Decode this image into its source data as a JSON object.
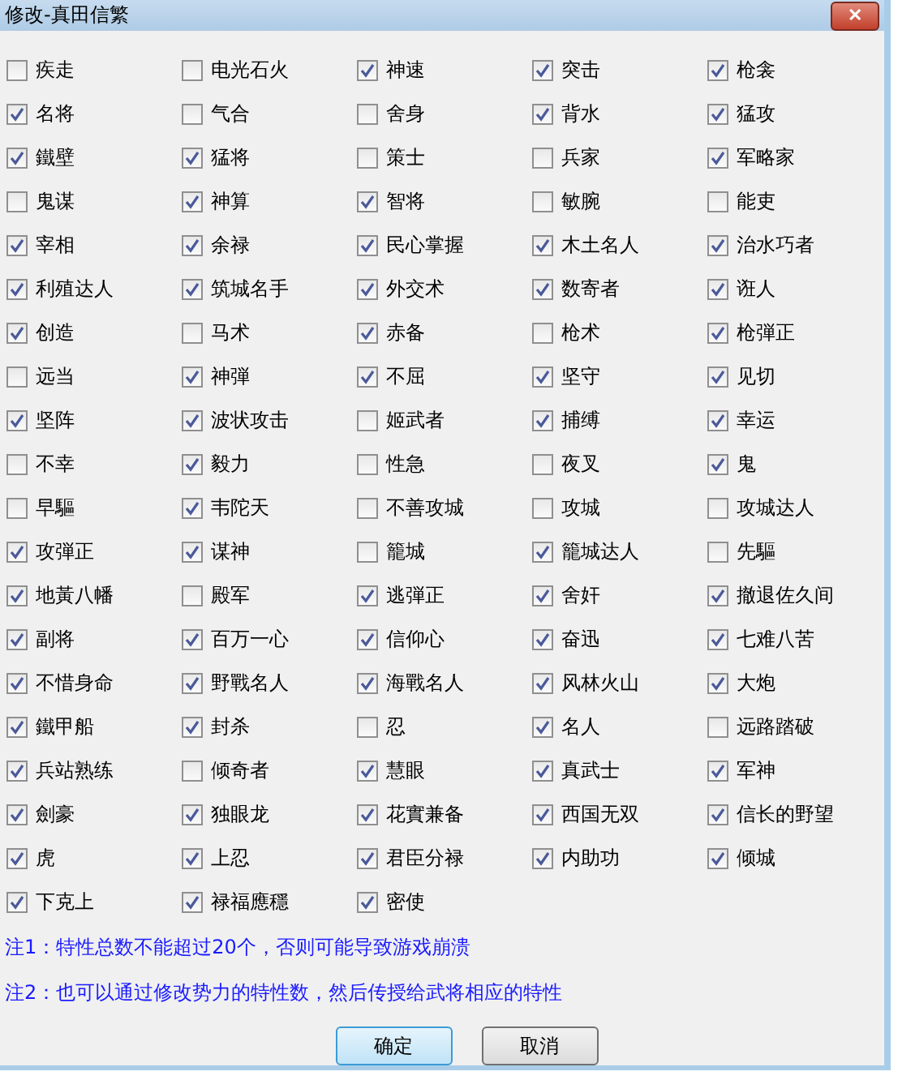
{
  "window": {
    "title": "修改-真田信繁",
    "close": "✕"
  },
  "traits": [
    {
      "label": "疾走",
      "checked": false
    },
    {
      "label": "电光石火",
      "checked": false
    },
    {
      "label": "神速",
      "checked": true
    },
    {
      "label": "突击",
      "checked": true
    },
    {
      "label": "枪衾",
      "checked": true
    },
    {
      "label": "名将",
      "checked": true
    },
    {
      "label": "气合",
      "checked": false
    },
    {
      "label": "舍身",
      "checked": false
    },
    {
      "label": "背水",
      "checked": true
    },
    {
      "label": "猛攻",
      "checked": true
    },
    {
      "label": "鐵壁",
      "checked": true
    },
    {
      "label": "猛将",
      "checked": true
    },
    {
      "label": "策士",
      "checked": false
    },
    {
      "label": "兵家",
      "checked": false
    },
    {
      "label": "军略家",
      "checked": true
    },
    {
      "label": "鬼谋",
      "checked": false
    },
    {
      "label": "神算",
      "checked": true
    },
    {
      "label": "智将",
      "checked": true
    },
    {
      "label": "敏腕",
      "checked": false
    },
    {
      "label": "能吏",
      "checked": false
    },
    {
      "label": "宰相",
      "checked": true
    },
    {
      "label": "余禄",
      "checked": true
    },
    {
      "label": "民心掌握",
      "checked": true
    },
    {
      "label": "木土名人",
      "checked": true
    },
    {
      "label": "治水巧者",
      "checked": true
    },
    {
      "label": "利殖达人",
      "checked": true
    },
    {
      "label": "筑城名手",
      "checked": true
    },
    {
      "label": "外交术",
      "checked": true
    },
    {
      "label": "数寄者",
      "checked": true
    },
    {
      "label": "诳人",
      "checked": true
    },
    {
      "label": "创造",
      "checked": true
    },
    {
      "label": "马术",
      "checked": false
    },
    {
      "label": "赤备",
      "checked": true
    },
    {
      "label": "枪术",
      "checked": false
    },
    {
      "label": "枪弾正",
      "checked": true
    },
    {
      "label": "远当",
      "checked": false
    },
    {
      "label": "神弾",
      "checked": true
    },
    {
      "label": "不屈",
      "checked": true
    },
    {
      "label": "坚守",
      "checked": true
    },
    {
      "label": "见切",
      "checked": true
    },
    {
      "label": "坚阵",
      "checked": true
    },
    {
      "label": "波状攻击",
      "checked": true
    },
    {
      "label": "姬武者",
      "checked": false
    },
    {
      "label": "捕缚",
      "checked": true
    },
    {
      "label": "幸运",
      "checked": true
    },
    {
      "label": "不幸",
      "checked": false
    },
    {
      "label": "毅力",
      "checked": true
    },
    {
      "label": "性急",
      "checked": false
    },
    {
      "label": "夜叉",
      "checked": false
    },
    {
      "label": "鬼",
      "checked": true
    },
    {
      "label": "早驅",
      "checked": false
    },
    {
      "label": "韦陀天",
      "checked": true
    },
    {
      "label": "不善攻城",
      "checked": false
    },
    {
      "label": "攻城",
      "checked": false
    },
    {
      "label": "攻城达人",
      "checked": false
    },
    {
      "label": "攻弾正",
      "checked": true
    },
    {
      "label": "谋神",
      "checked": true
    },
    {
      "label": "籠城",
      "checked": false
    },
    {
      "label": "籠城达人",
      "checked": true
    },
    {
      "label": "先驅",
      "checked": false
    },
    {
      "label": "地黃八幡",
      "checked": true
    },
    {
      "label": "殿军",
      "checked": false
    },
    {
      "label": "逃弾正",
      "checked": true
    },
    {
      "label": "舍奸",
      "checked": true
    },
    {
      "label": "撤退佐久间",
      "checked": true
    },
    {
      "label": "副将",
      "checked": true
    },
    {
      "label": "百万一心",
      "checked": true
    },
    {
      "label": "信仰心",
      "checked": true
    },
    {
      "label": "奋迅",
      "checked": true
    },
    {
      "label": "七难八苦",
      "checked": true
    },
    {
      "label": "不惜身命",
      "checked": true
    },
    {
      "label": "野戰名人",
      "checked": true
    },
    {
      "label": "海戰名人",
      "checked": true
    },
    {
      "label": "风林火山",
      "checked": true
    },
    {
      "label": "大炮",
      "checked": true
    },
    {
      "label": "鐵甲船",
      "checked": true
    },
    {
      "label": "封杀",
      "checked": true
    },
    {
      "label": "忍",
      "checked": false
    },
    {
      "label": "名人",
      "checked": true
    },
    {
      "label": "远路踏破",
      "checked": false
    },
    {
      "label": "兵站熟练",
      "checked": true
    },
    {
      "label": "倾奇者",
      "checked": false
    },
    {
      "label": "慧眼",
      "checked": true
    },
    {
      "label": "真武士",
      "checked": true
    },
    {
      "label": "军神",
      "checked": true
    },
    {
      "label": "劍豪",
      "checked": true
    },
    {
      "label": "独眼龙",
      "checked": true
    },
    {
      "label": "花實兼备",
      "checked": true
    },
    {
      "label": "西国无双",
      "checked": true
    },
    {
      "label": "信长的野望",
      "checked": true
    },
    {
      "label": "虎",
      "checked": true
    },
    {
      "label": "上忍",
      "checked": true
    },
    {
      "label": "君臣分禄",
      "checked": true
    },
    {
      "label": "内助功",
      "checked": true
    },
    {
      "label": "倾城",
      "checked": true
    },
    {
      "label": "下克上",
      "checked": true
    },
    {
      "label": "禄福應穩",
      "checked": true
    },
    {
      "label": "密使",
      "checked": true
    }
  ],
  "notes": [
    "注1：特性总数不能超过20个，否则可能导致游戏崩溃",
    "注2：也可以通过修改势力的特性数，然后传授给武将相应的特性"
  ],
  "buttons": [
    {
      "label": "确定",
      "selected": true
    },
    {
      "label": "取消",
      "selected": false
    }
  ]
}
